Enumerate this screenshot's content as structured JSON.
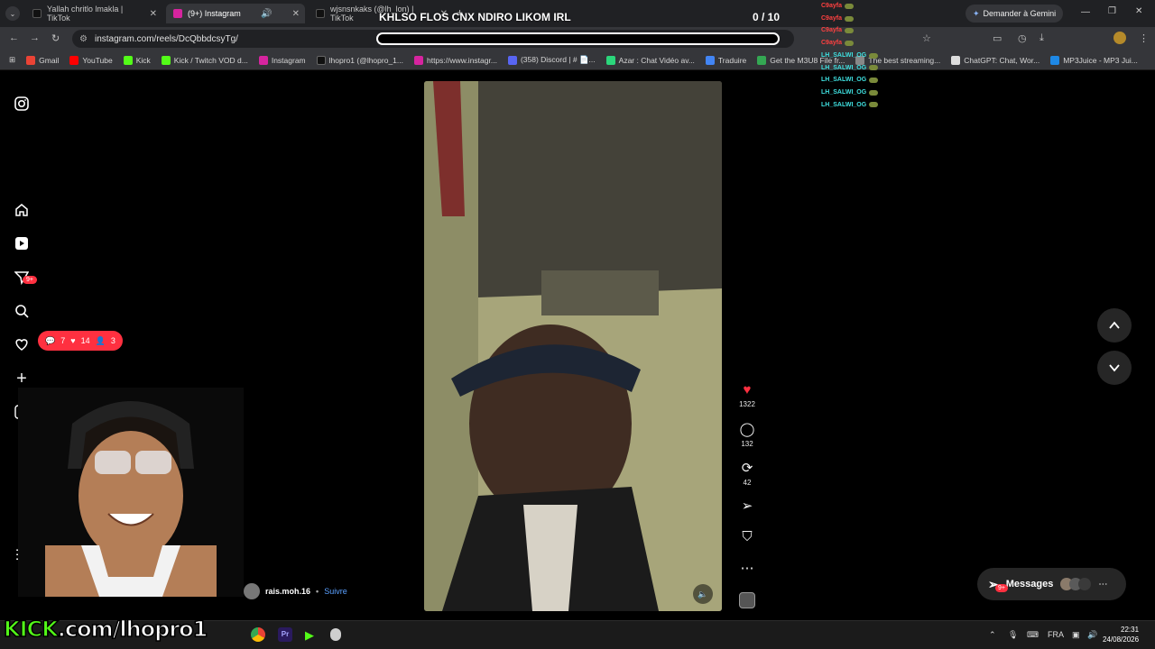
{
  "browser": {
    "tabs": [
      {
        "label": "Yallah chritlo lmakla | TikTok",
        "color": "#111111"
      },
      {
        "label": "(9+) Instagram",
        "color": "#d6249f"
      },
      {
        "label": "wjsnsnkaks (@lh_lon) | TikTok",
        "color": "#111111"
      }
    ],
    "gemini_button": "Demander à Gemini",
    "url": "instagram.com/reels/DcQbbdcsyTg/",
    "bookmarks": [
      "Gmail",
      "YouTube",
      "Kick",
      "Kick / Twitch VOD d...",
      "Instagram",
      "lhopro1 (@lhopro_1...",
      "https://www.instagr...",
      "(358) Discord | # 📄...",
      "Azar : Chat Vidéo av...",
      "Traduire",
      "Get the M3U8 File fr...",
      "The best streaming...",
      "ChatGPT: Chat, Wor...",
      "MP3Juice - MP3 Jui..."
    ]
  },
  "stream": {
    "title": "KHLSO FLOS CNX NDIRO LIKOM IRL",
    "progress": "0 / 10",
    "chat": [
      {
        "name": "C9ayfa",
        "color": "#ff4040"
      },
      {
        "name": "C9ayfa",
        "color": "#ff4040"
      },
      {
        "name": "C9ayfa",
        "color": "#ff4040"
      },
      {
        "name": "C9ayfa",
        "color": "#ff4040"
      },
      {
        "name": "LH_SALWI_OG",
        "color": "#3fe0e0"
      },
      {
        "name": "LH_SALWI_OG",
        "color": "#3fe0e0"
      },
      {
        "name": "LH_SALWI_OG",
        "color": "#3fe0e0"
      },
      {
        "name": "LH_SALWI_OG",
        "color": "#3fe0e0"
      },
      {
        "name": "LH_SALWI_OG",
        "color": "#3fe0e0"
      }
    ],
    "kick_logo": "KICK.com/lhopro1"
  },
  "instagram": {
    "notifications_badge": "9+",
    "notif_pill": {
      "comments": "7",
      "likes": "14",
      "follows": "3"
    },
    "reel": {
      "likes": "1322",
      "comments": "132",
      "reposts": "42",
      "author": "rais.moh.16",
      "follow": "Suivre"
    },
    "messages": {
      "label": "Messages",
      "badge": "9+"
    }
  },
  "taskbar": {
    "lang": "FRA",
    "time": "22:31",
    "date": "24/08/2026"
  },
  "colors": {
    "like_red": "#ff3040",
    "kick_green": "#53fc18",
    "ig_bg": "#000000"
  }
}
